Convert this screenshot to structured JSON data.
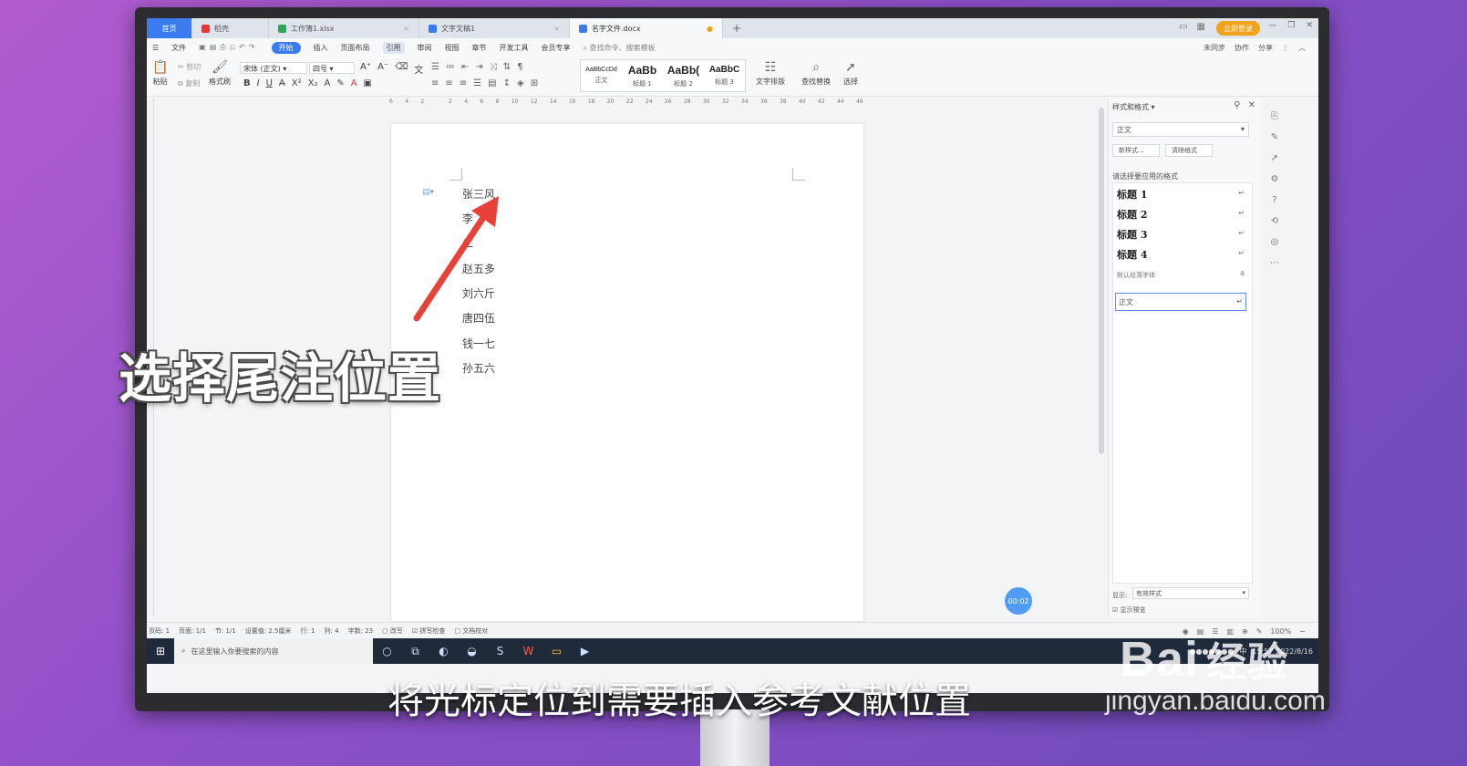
{
  "tabs": [
    {
      "label": "首页",
      "kind": "home"
    },
    {
      "label": "稻壳",
      "kind": "docer"
    },
    {
      "label": "工作簿1.xlsx",
      "kind": "sheet"
    },
    {
      "label": "文字文稿1",
      "kind": "doc"
    },
    {
      "label": "名字文件.docx",
      "kind": "doc-active"
    }
  ],
  "login_label": "立即登录",
  "menu": [
    "文件",
    "开始",
    "插入",
    "页面布局",
    "引用",
    "审阅",
    "视图",
    "章节",
    "开发工具",
    "会员专享"
  ],
  "menu_active": "开始",
  "menu_hover": "引用",
  "menu_search": "查找命令、搜索模板",
  "menu_right": [
    "未同步",
    "协作",
    "分享"
  ],
  "ribbon": {
    "paste": "粘贴",
    "cut": "剪切",
    "copy": "复制",
    "format_painter": "格式刷",
    "font": "宋体 (正文)",
    "size": "四号",
    "styles": [
      {
        "preview": "AaBbCcDd",
        "label": "正文"
      },
      {
        "preview": "AaBb",
        "label": "标题 1"
      },
      {
        "preview": "AaBb(",
        "label": "标题 2"
      },
      {
        "preview": "AaBbC",
        "label": "标题 3"
      }
    ],
    "text_layout": "文字排版",
    "find_replace": "查找替换",
    "select": "选择"
  },
  "ruler_ticks": [
    "6",
    "4",
    "2",
    "",
    "2",
    "4",
    "6",
    "8",
    "10",
    "12",
    "14",
    "16",
    "18",
    "20",
    "22",
    "24",
    "26",
    "28",
    "30",
    "32",
    "34",
    "36",
    "38",
    "40",
    "42",
    "44",
    "46"
  ],
  "document_lines": [
    "张三风",
    "李",
    "二",
    "赵五多",
    "刘六斤",
    "唐四伍",
    "钱一七",
    "孙五六"
  ],
  "panel": {
    "title": "样式和格式",
    "current": "正文",
    "new_style": "新样式...",
    "clear_format": "清除格式",
    "apply_label": "请选择要应用的格式",
    "items": [
      "标题 1",
      "标题 2",
      "标题 3",
      "标题 4"
    ],
    "default_font": "默认段落字体",
    "normal": "正文",
    "show_label": "显示:",
    "show_value": "有效样式",
    "preview_label": "显示预览"
  },
  "timer": "00:02",
  "status": [
    "页码: 1",
    "页面: 1/1",
    "节: 1/1",
    "设置值: 2.5厘米",
    "行: 1",
    "列: 4",
    "字数: 23",
    "改写",
    "拼写检查",
    "文档校对"
  ],
  "zoom": "100%",
  "taskbar": {
    "search_placeholder": "在这里输入你要搜索的内容",
    "time": "15:57",
    "date": "2022/8/16",
    "ime": "中"
  },
  "overlay_title": "选择尾注位置",
  "subtitle": "将光标定位到需要插入参考文献位置",
  "watermark": {
    "logo": "Bai",
    "logo_cn": "经验",
    "url": "jingyan.baidu.com"
  },
  "colors": {
    "accent": "#3a7bf0",
    "arrow": "#e8413a",
    "login": "#f0a21a"
  }
}
